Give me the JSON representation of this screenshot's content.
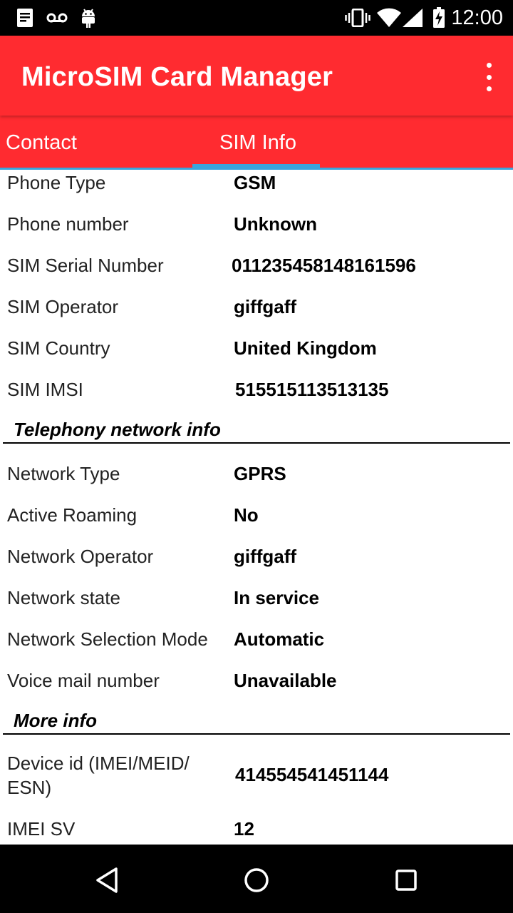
{
  "status_bar": {
    "time": "12:00",
    "left_icons": [
      "notes-icon",
      "voicemail-icon",
      "android-icon"
    ],
    "right_icons": [
      "vibrate-icon",
      "wifi-icon",
      "signal-icon",
      "battery-charging-icon"
    ]
  },
  "app_bar": {
    "title": "MicroSIM Card Manager",
    "background_color": "#ff2b30"
  },
  "tabs": [
    {
      "label": "Contact",
      "selected": false
    },
    {
      "label": "SIM Info",
      "selected": true
    }
  ],
  "tab_indicator_color": "#3aa5dc",
  "sim_info": [
    {
      "label": "Phone Type",
      "value": "GSM"
    },
    {
      "label": "Phone number",
      "value": "Unknown"
    },
    {
      "label": "SIM Serial Number",
      "value": "011235458148161596"
    },
    {
      "label": "SIM Operator",
      "value": "giffgaff"
    },
    {
      "label": "SIM Country",
      "value": "United Kingdom"
    },
    {
      "label": "SIM IMSI",
      "value": "515515113513135"
    }
  ],
  "telephony_section": {
    "title": "Telephony network info",
    "rows": [
      {
        "label": "Network Type",
        "value": "GPRS"
      },
      {
        "label": "Active Roaming",
        "value": "No"
      },
      {
        "label": "Network Operator",
        "value": "giffgaff"
      },
      {
        "label": "Network state",
        "value": "In service"
      },
      {
        "label": "Network Selection Mode",
        "value": "Automatic"
      },
      {
        "label": "Voice mail number",
        "value": "Unavailable"
      }
    ]
  },
  "more_section": {
    "title": "More info",
    "rows": [
      {
        "label": "Device id (IMEI/MEID/ ESN)",
        "label_line1": "Device id (IMEI/MEID/",
        "label_line2": "ESN)",
        "value": "414554541451144"
      },
      {
        "label": "IMEI SV",
        "value": "12"
      }
    ]
  },
  "nav_bar": {
    "buttons": [
      "back-icon",
      "home-icon",
      "recents-icon"
    ]
  }
}
